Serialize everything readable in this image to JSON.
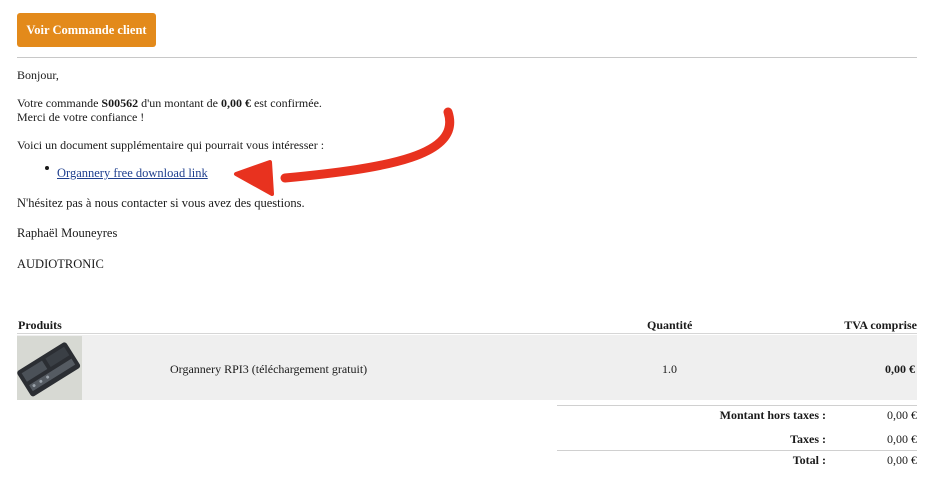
{
  "header": {
    "cta_label": "Voir Commande client"
  },
  "message": {
    "greeting": "Bonjour,",
    "line1_prefix": "Votre commande ",
    "order_number": "S00562",
    "line1_mid": " d'un montant de ",
    "amount": "0,00 €",
    "line1_suffix": " est confirmée.",
    "thanks": "Merci de votre confiance !",
    "doc_intro": "Voici un document supplémentaire qui pourrait vous intéresser :",
    "doc_link": "Organnery free download link",
    "contact": "N'hésitez pas à nous contacter si vous avez des questions.",
    "signature_name": "Raphaël Mouneyres",
    "signature_company": "AUDIOTRONIC"
  },
  "table": {
    "headers": {
      "product": "Produits",
      "quantity": "Quantité",
      "tax": "TVA comprise"
    },
    "rows": [
      {
        "name": "Organnery RPI3 (téléchargement gratuit)",
        "quantity": "1.0",
        "price": "0,00 €"
      }
    ]
  },
  "totals": {
    "untaxed_label": "Montant hors taxes :",
    "untaxed_value": "0,00 €",
    "taxes_label": "Taxes :",
    "taxes_value": "0,00 €",
    "total_label": "Total :",
    "total_value": "0,00 €"
  },
  "colors": {
    "accent": "#e38a1b",
    "link": "#1f3f8e",
    "arrow": "#e8321f"
  },
  "icons": {
    "annotation": "red-arrow-icon",
    "product_thumbnail": "device-thumbnail-icon"
  }
}
